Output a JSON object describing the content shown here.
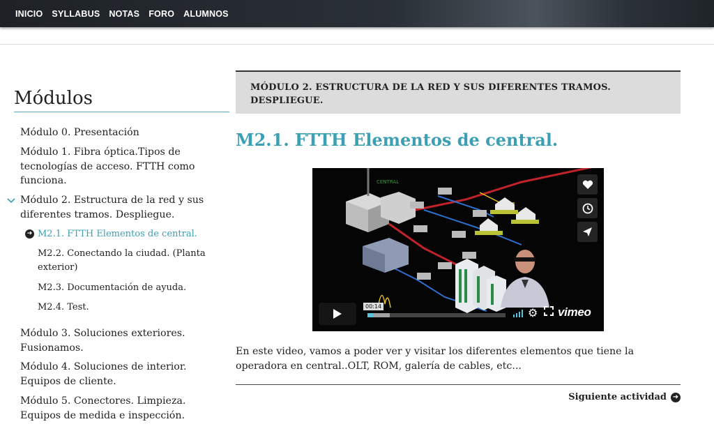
{
  "nav": {
    "items": [
      "INICIO",
      "SYLLABUS",
      "NOTAS",
      "FORO",
      "ALUMNOS"
    ]
  },
  "sidebar": {
    "title": "Módulos",
    "modules": [
      "Módulo 0. Presentación",
      "Módulo 1. Fibra óptica.Tipos de tecnologías de acceso. FTTH como funciona.",
      "Módulo 2. Estructura de la red y sus diferentes tramos. Despliegue.",
      "Módulo 3. Soluciones exteriores. Fusionamos.",
      "Módulo 4. Soluciones de interior. Equipos de cliente.",
      "Módulo 5. Conectores. Limpieza. Equipos de medida e inspección."
    ],
    "sub_items": [
      "M2.1. FTTH Elementos de central.",
      "M2.2. Conectando la ciudad. (Planta exterior)",
      "M2.3. Documentación de ayuda.",
      "M2.4. Test."
    ],
    "expanded_module_index": 2,
    "active_sub_index": 0
  },
  "main": {
    "module_header": "MÓDULO 2. ESTRUCTURA DE LA RED Y SUS DIFERENTES TRAMOS. DESPLIEGUE.",
    "activity_title": "M2.1. FTTH Elementos de central.",
    "description": "En este video, vamos a poder ver y visitar los diferentes elementos que tiene la operadora en central..OLT, ROM, galería de cables, etc...",
    "next_label": "Siguiente actividad"
  },
  "video": {
    "time": "00:14",
    "brand": "vimeo",
    "scene_label": "CENTRAL",
    "progress": 0.04,
    "loaded": 0.16,
    "side_buttons": [
      "heart-icon",
      "clock-icon",
      "send-icon"
    ]
  },
  "colors": {
    "accent": "#3c9fb3",
    "header_bg": "#dcdcdc",
    "nav_bg": "#2a3037",
    "video_progress": "#5ac4de"
  }
}
